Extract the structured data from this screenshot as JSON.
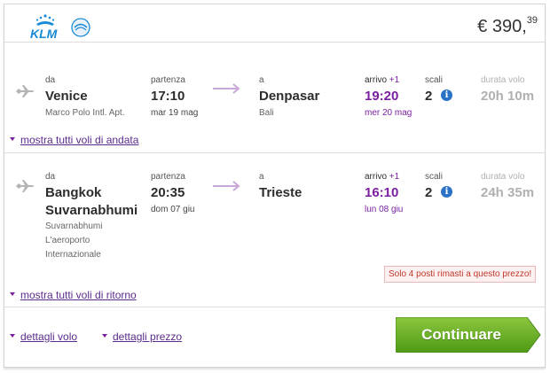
{
  "header": {
    "airline": "KLM",
    "price_main": "€ 390,",
    "price_cents": "39"
  },
  "outbound": {
    "from_label": "da",
    "from_city": "Venice",
    "from_airport": "Marco Polo Intl. Apt.",
    "dep_label": "partenza",
    "dep_time": "17:10",
    "dep_date": "mar 19 mag",
    "to_label": "a",
    "to_city": "Denpasar",
    "to_airport": "Bali",
    "arr_label": "arrivo",
    "arr_plus": "+1",
    "arr_time": "19:20",
    "arr_date": "mer 20 mag",
    "stops_label": "scali",
    "stops": "2",
    "duration_label": "durata volo",
    "duration": "20h 10m",
    "show_all": "mostra tutti voli di andata"
  },
  "return": {
    "from_label": "da",
    "from_city_1": "Bangkok",
    "from_city_2": "Suvarnabhumi",
    "from_airport_1": "Suvarnabhumi",
    "from_airport_2": "L'aeroporto",
    "from_airport_3": "Internazionale",
    "dep_label": "partenza",
    "dep_time": "20:35",
    "dep_date": "dom 07 giu",
    "to_label": "a",
    "to_city": "Trieste",
    "arr_label": "arrivo",
    "arr_plus": "+1",
    "arr_time": "16:10",
    "arr_date": "lun 08 giu",
    "stops_label": "scali",
    "stops": "2",
    "duration_label": "durata volo",
    "duration": "24h 35m",
    "warning": "Solo 4 posti rimasti a questo prezzo!",
    "show_all": "mostra tutti voli di ritorno"
  },
  "footer": {
    "flight_details": "dettagli volo",
    "price_details": "dettagli prezzo",
    "continue": "Continuare"
  },
  "icons": {
    "plane": "plane-icon",
    "arrow": "arrow-right-icon",
    "info": "info-icon",
    "caret": "caret-down-icon"
  },
  "colors": {
    "accent_purple": "#7a1fa2",
    "info_blue": "#2a72c6",
    "button_green": "#5ea51d",
    "klm_blue": "#1a8ad6"
  }
}
